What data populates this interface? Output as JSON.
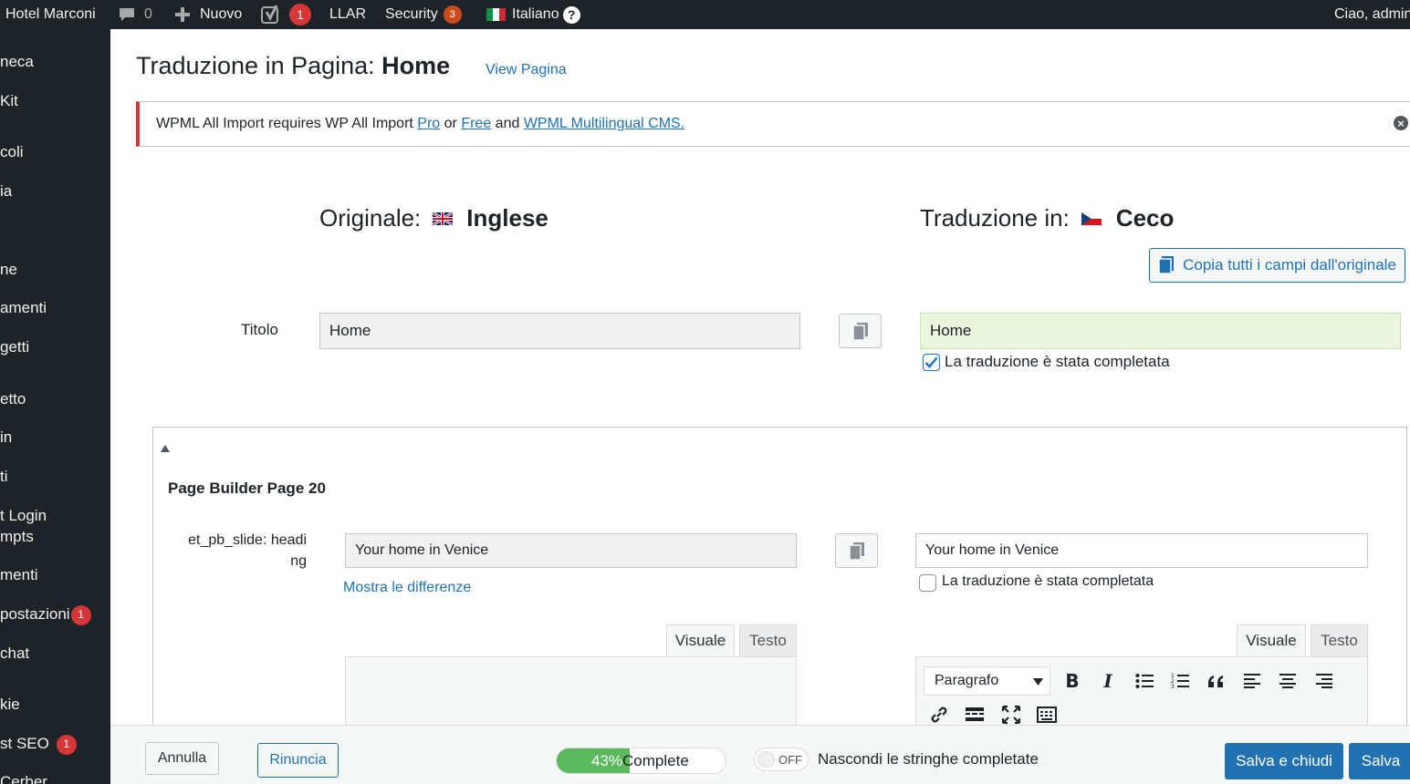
{
  "adminbar": {
    "site_name": "Hotel Marconi",
    "comments_count": "0",
    "new_label": "Nuovo",
    "yoast_badge": "1",
    "llar_label": "LLAR",
    "security_label": "Security",
    "security_badge": "3",
    "language_label": "Italiano",
    "greeting": "Ciao, admin"
  },
  "sidebar": {
    "items": [
      {
        "label": "neca"
      },
      {
        "label": "Kit"
      },
      {
        "label": "coli"
      },
      {
        "label": "ia"
      },
      {
        "label": "ne"
      },
      {
        "label": "amenti"
      },
      {
        "label": "getti"
      },
      {
        "label": "etto"
      },
      {
        "label": "in"
      },
      {
        "label": "ti"
      },
      {
        "label": "t Login"
      },
      {
        "label": "mpts"
      },
      {
        "label": "menti"
      },
      {
        "label": "postazioni",
        "badge": "1"
      },
      {
        "label": "chat"
      },
      {
        "label": "kie"
      },
      {
        "label": "st SEO",
        "badge": "1"
      },
      {
        "label": "Cerber"
      }
    ]
  },
  "page": {
    "title_prefix": "Traduzione in Pagina: ",
    "title_strong": "Home",
    "view_link": "View Pagina"
  },
  "notice": {
    "text_1": "WPML All Import requires WP All Import ",
    "link_pro": "Pro",
    "text_2": " or ",
    "link_free": "Free",
    "text_3": " and ",
    "link_wpml": "WPML Multilingual CMS."
  },
  "languages": {
    "original_label": "Originale:",
    "original_name": "Inglese",
    "target_label": "Traduzione in:",
    "target_name": "Ceco",
    "copy_all_label": "Copia tutti i campi dall'originale"
  },
  "title_field": {
    "label": "Titolo",
    "original_value": "Home",
    "translated_value": "Home",
    "complete_label": "La traduzione è stata completata",
    "complete_checked": true
  },
  "section": {
    "title": "Page Builder Page 20",
    "field_label_1": "et_pb_slide: headi",
    "field_label_2": "ng",
    "original_value": "Your home in Venice",
    "translated_value": "Your home in Venice",
    "show_diff_link": "Mostra le differenze",
    "complete_label": "La traduzione è stata completata",
    "complete_checked": false,
    "tab_visual": "Visuale",
    "tab_text": "Testo",
    "format_select": "Paragrafo"
  },
  "footer": {
    "cancel_label": "Annulla",
    "resign_label": "Rinuncia",
    "progress_percent": "43%",
    "progress_text": "Complete",
    "progress_value": 43,
    "toggle_label": "OFF",
    "hide_completed_label": "Nascondi le stringhe completate",
    "save_close_label": "Salva e chiudi",
    "save_label": "Salva"
  },
  "colors": {
    "admin_bar": "#1d2327",
    "link": "#2271b1",
    "primary_button": "#2271b1",
    "notice_border": "#d63638",
    "completed_field": "#e9f5dd",
    "progress": "#5cb85c",
    "badge": "#d63638",
    "security_badge": "#ca4a1f"
  }
}
